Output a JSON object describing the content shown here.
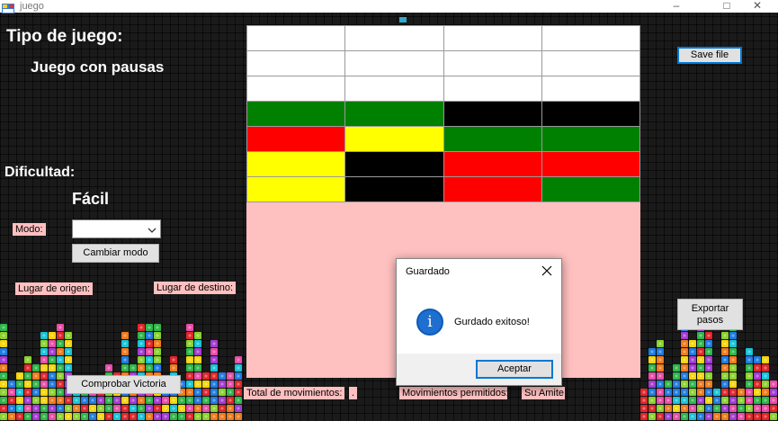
{
  "window": {
    "title": "juego"
  },
  "labels": {
    "game_type_heading": "Tipo de juego:",
    "game_type_value": "Juego con pausas",
    "difficulty_heading": "Dificultad:",
    "difficulty_value": "Fácil",
    "mode": "Modo:",
    "origin": "Lugar de origen:",
    "destination": "Lugar de destino:",
    "total_moves": "Total de movimientos:",
    "total_moves_value": ".",
    "allowed_moves_partial": "Movimientos permitidos:",
    "partial_right": "Su Amite"
  },
  "mode_select": {
    "selected": ""
  },
  "buttons": {
    "change_mode": "Cambiar modo",
    "save_file": "Save file",
    "export_steps": "Exportar pasos",
    "check_victory": "Comprobar Victoria"
  },
  "board": {
    "columns": 4,
    "rows": [
      [
        "white",
        "white",
        "white",
        "white"
      ],
      [
        "white",
        "white",
        "white",
        "white"
      ],
      [
        "white",
        "white",
        "white",
        "white"
      ],
      [
        "green",
        "green",
        "black",
        "black"
      ],
      [
        "red",
        "yellow",
        "green",
        "green"
      ],
      [
        "yellow",
        "black",
        "red",
        "red"
      ],
      [
        "yellow",
        "black",
        "red",
        "green"
      ]
    ],
    "color_map": {
      "white": "#ffffff",
      "green": "#008000",
      "black": "#000000",
      "red": "#ff0000",
      "yellow": "#ffff00"
    },
    "background": "#ffc0c0"
  },
  "dialog": {
    "title": "Guardado",
    "message": "Gurdado exitoso!",
    "ok_button": "Aceptar",
    "icon": "info-icon"
  },
  "icons": {
    "app": "app-icon",
    "minimize": "minimize-icon",
    "maximize": "maximize-icon",
    "close": "close-icon",
    "dropdown": "chevron-down-icon"
  }
}
